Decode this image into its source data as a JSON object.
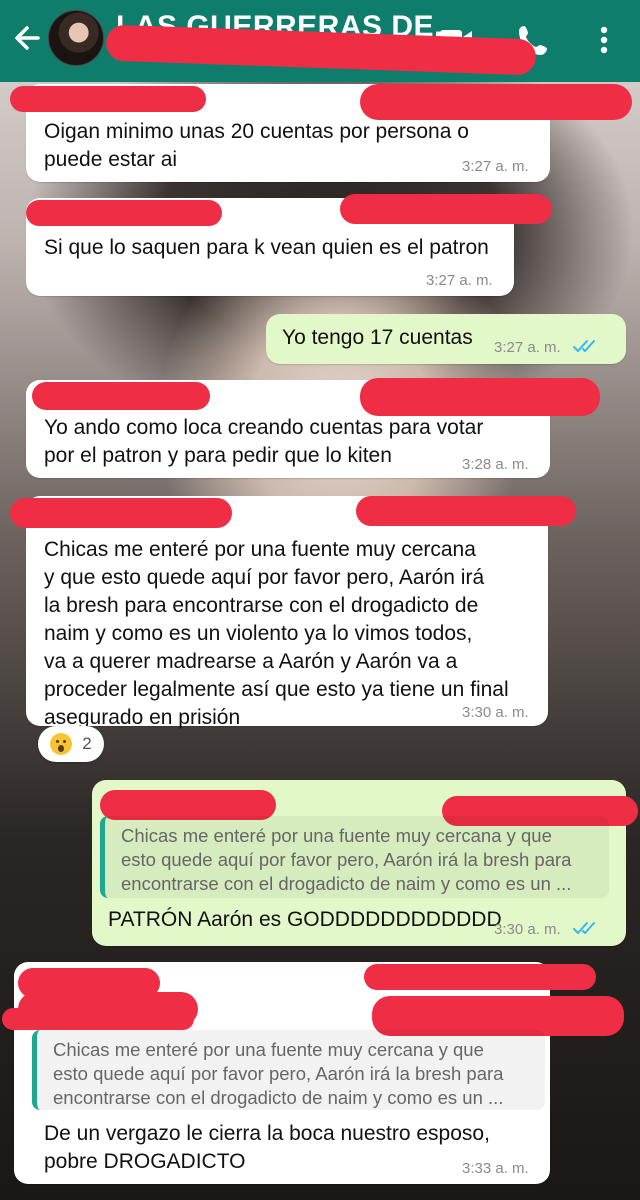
{
  "header": {
    "title": "LAS GUERRERAS DE...",
    "back_icon": "back-arrow-icon",
    "video_icon": "video-call-icon",
    "call_icon": "phone-icon",
    "menu_icon": "more-vert-icon",
    "color": "#0e7d6c"
  },
  "messages": [
    {
      "direction": "in",
      "text": "Oigan minimo unas 20 cuentas por persona o\npuede estar ai",
      "time": "3:27 a. m."
    },
    {
      "direction": "in",
      "text": "Si que lo saquen para k vean quien es el patron",
      "time": "3:27 a. m."
    },
    {
      "direction": "out",
      "text": "Yo tengo 17 cuentas",
      "time": "3:27 a. m.",
      "status": "read"
    },
    {
      "direction": "in",
      "text": "Yo ando como loca creando cuentas para votar\npor el patron y para pedir que lo kiten",
      "time": "3:28 a. m."
    },
    {
      "direction": "in",
      "text": "Chicas me enteré por una fuente muy cercana\ny que esto quede aquí por favor pero, Aarón irá\nla bresh para encontrarse con el drogadicto de\nnaim y como es un violento ya lo vimos todos,\nva a querer madrearse a Aarón y Aarón va a\nproceder legalmente así que esto ya tiene un final\nasegurado en prisión",
      "time": "3:30 a. m.",
      "reaction": {
        "emoji": "astonished-face",
        "count": "2"
      }
    },
    {
      "direction": "out",
      "quote": "Chicas me enteré por una fuente muy cercana y que\nesto quede aquí por favor pero, Aarón irá la bresh para\nencontrarse con el drogadicto de naim y como es un ...",
      "text": "PATRÓN Aarón es GODDDDDDDDDDDD",
      "time": "3:30 a. m.",
      "status": "read"
    },
    {
      "direction": "in",
      "quote": "Chicas me enteré por una fuente muy cercana y que\nesto quede aquí por favor pero, Aarón irá la bresh para\nencontrarse con el drogadicto de naim y como es un ...",
      "text": "De un vergazo le cierra la boca nuestro esposo,\npobre DROGADICTO",
      "time": "3:33 a. m."
    }
  ],
  "colors": {
    "incoming_bubble": "#ffffff",
    "outgoing_bubble": "#e2f8c9",
    "quote_bar": "#1fa890",
    "read_ticks": "#34b7f1",
    "redaction": "#ef2e45"
  }
}
